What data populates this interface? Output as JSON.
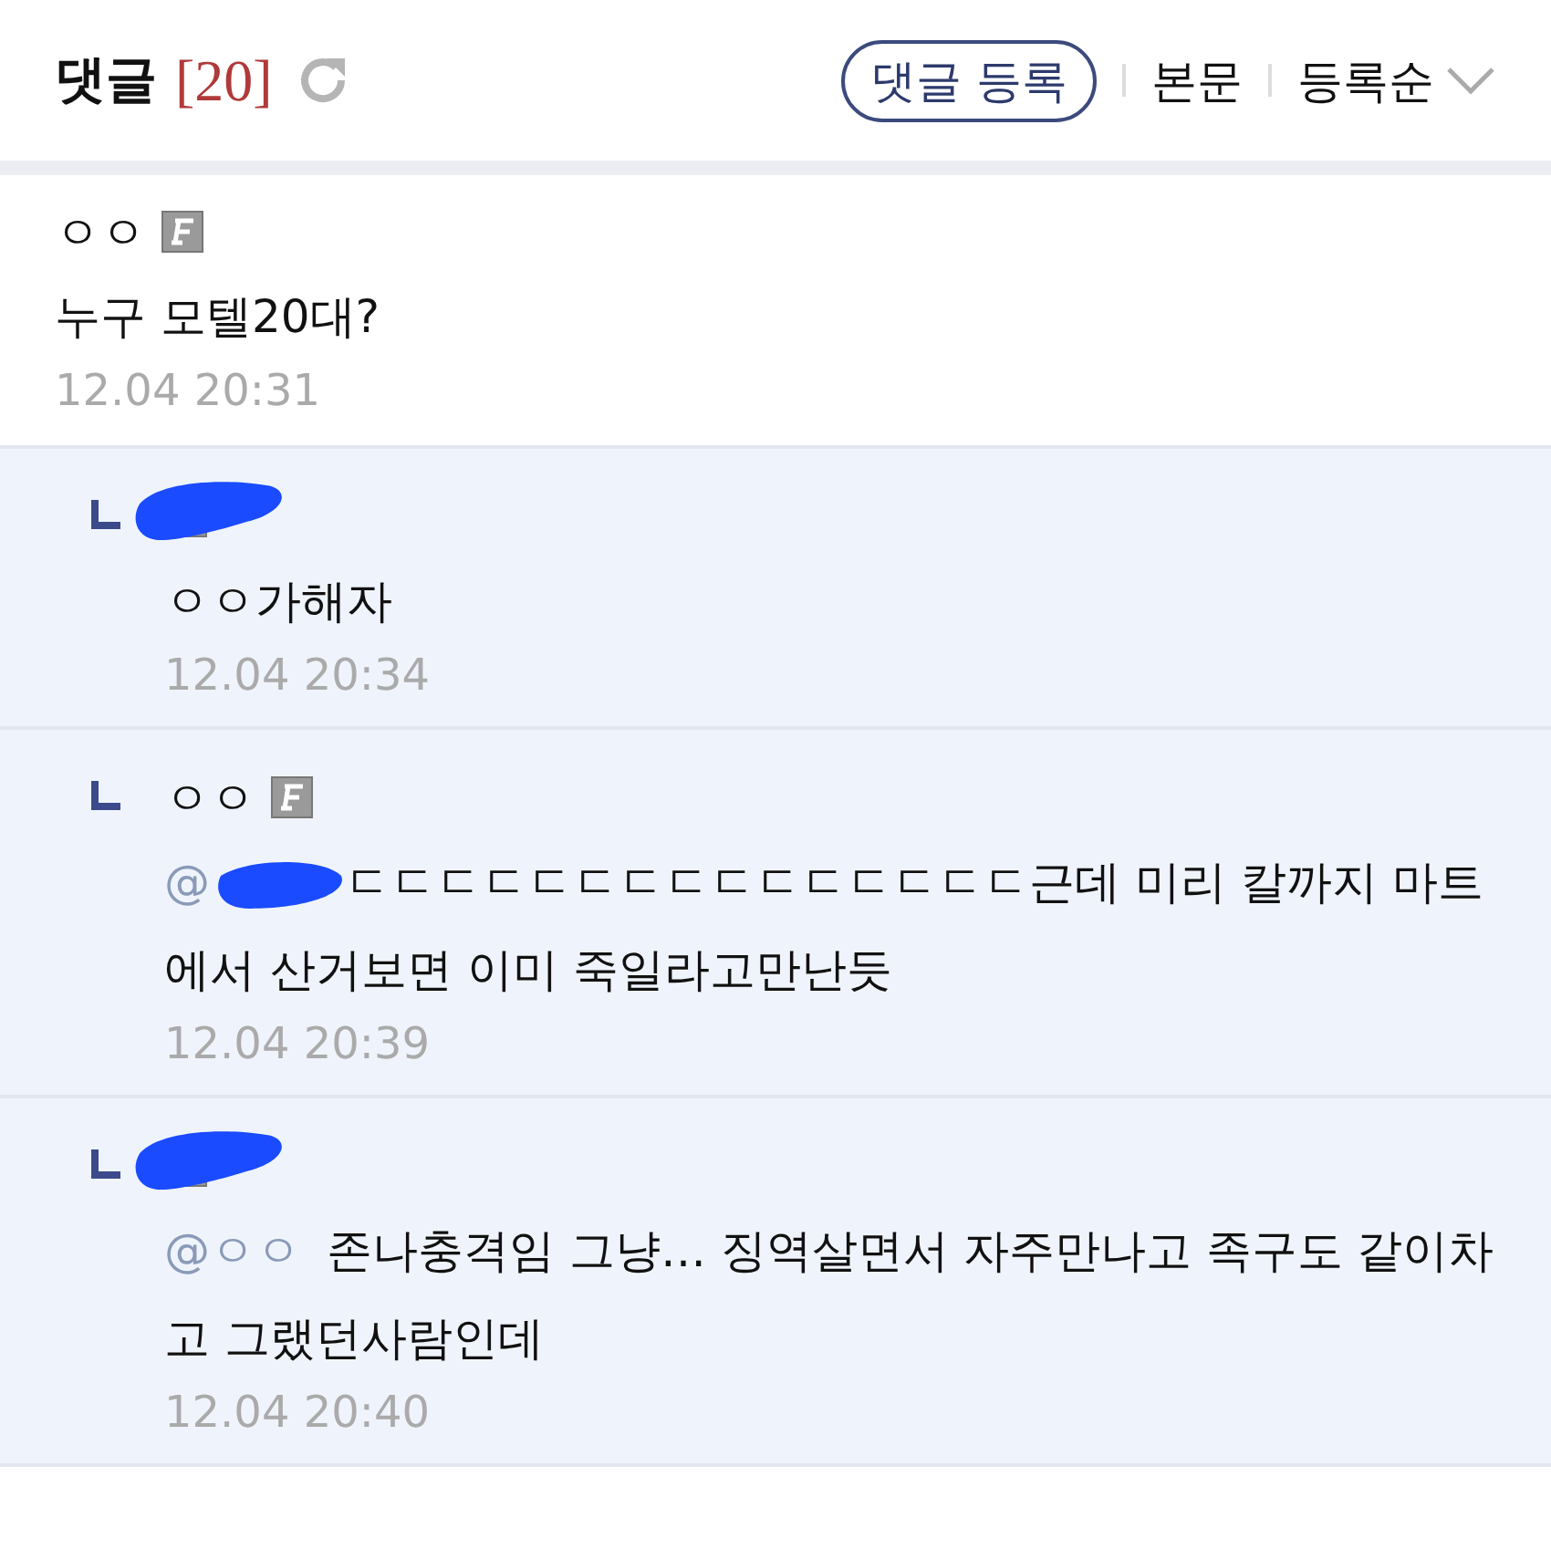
{
  "header": {
    "title": "댓글",
    "count": "[20]",
    "buttons": [
      {
        "label": "댓글 등록",
        "kind": "outlined"
      },
      {
        "label": "본문",
        "kind": "plain"
      },
      {
        "label": "등록순",
        "kind": "dropdown"
      }
    ]
  },
  "comments": [
    {
      "reply": false,
      "author": "ㅇㅇ",
      "author_redacted": false,
      "text": "누구 모텔20대?",
      "time": "12.04 20:31"
    },
    {
      "reply": true,
      "author_redacted": true,
      "text": "ㅇㅇ가해자",
      "time": "12.04 20:34"
    },
    {
      "reply": true,
      "author": "ㅇㅇ",
      "author_redacted": false,
      "mention": "@",
      "mention_redacted": true,
      "text": "ㄷㄷㄷㄷㄷㄷㄷㄷㄷㄷㄷㄷㄷㄷㄷ근데 미리 칼까지 마트에서 산거보면 이미 죽일라고만난듯",
      "time": "12.04 20:39"
    },
    {
      "reply": true,
      "author_redacted": true,
      "mention": "@ㅇㅇ",
      "mention_redacted": false,
      "text": "존나충격임 그냥… 징역살면서 자주만나고 족구도 같이차고 그랬던사람인데",
      "time": "12.04 20:40"
    }
  ]
}
